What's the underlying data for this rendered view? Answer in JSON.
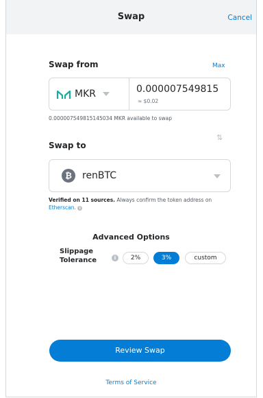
{
  "header": {
    "title": "Swap",
    "cancel_label": "Cancel"
  },
  "swap_from": {
    "label": "Swap from",
    "max_label": "Max",
    "token_symbol": "MKR",
    "token_icon": "maker-logo-icon",
    "amount": "0.000007549815",
    "fiat_value": "≈ $0.02",
    "available_text": "0.000007549815145034 MKR available to swap"
  },
  "swap_to": {
    "label": "Swap to",
    "token_symbol": "renBTC",
    "token_icon": "bitcoin-logo-icon",
    "verified_bold": "Verified on 11 sources.",
    "verified_text": " Always confirm the token address on ",
    "etherscan_link": "Etherscan."
  },
  "advanced": {
    "title": "Advanced Options",
    "slippage_line1": "Slippage",
    "slippage_line2": "Tolerance",
    "options": [
      "2%",
      "3%",
      "custom"
    ],
    "selected": "3%"
  },
  "footer": {
    "review_label": "Review Swap",
    "terms_label": "Terms of Service"
  },
  "colors": {
    "accent": "#037dd6",
    "header_bg": "#f2f3f4",
    "maker_teal": "#1aab9b",
    "border": "#d6d9dc"
  }
}
